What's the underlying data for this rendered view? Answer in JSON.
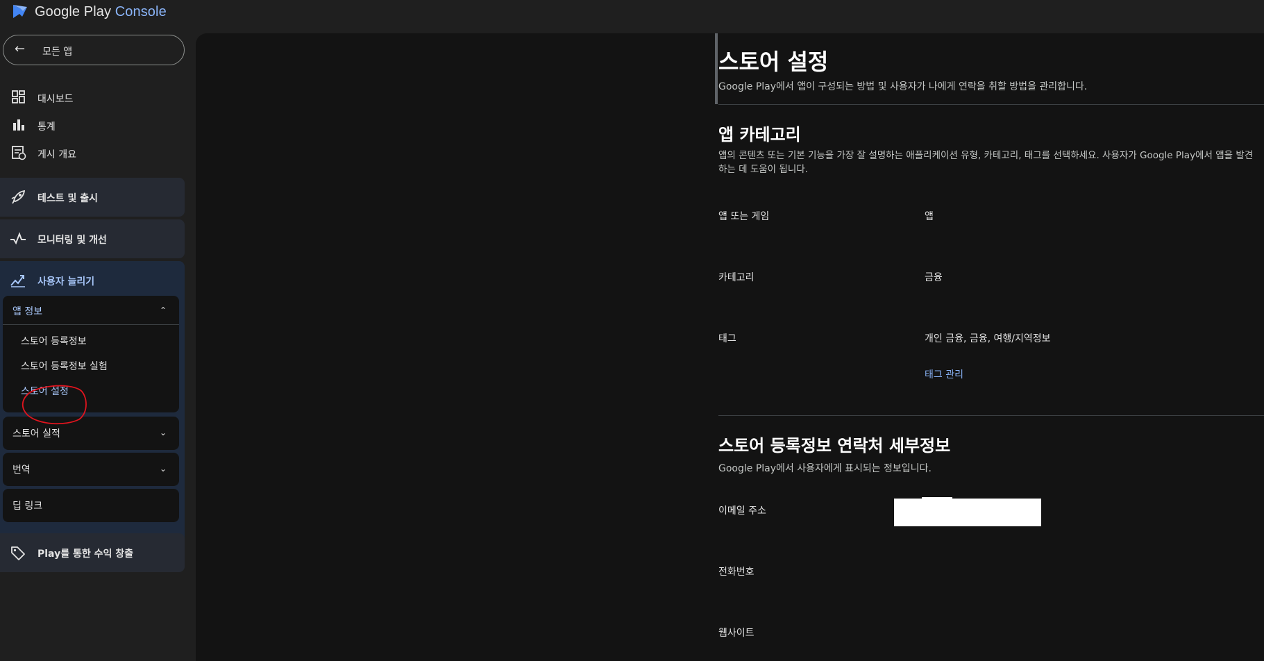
{
  "brand": {
    "name_part1": "Google Play ",
    "name_part2": "Console"
  },
  "sidebar": {
    "back_label": "모든 앱",
    "items": [
      {
        "label": "대시보드",
        "icon": "dashboard-icon"
      },
      {
        "label": "통계",
        "icon": "bar-chart-icon"
      },
      {
        "label": "게시 개요",
        "icon": "publishing-overview-icon"
      }
    ],
    "groups": [
      {
        "label": "테스트 및 출시",
        "icon": "rocket-icon"
      },
      {
        "label": "모니터링 및 개선",
        "icon": "pulse-icon"
      }
    ],
    "grow": {
      "label": "사용자 늘리기",
      "icon": "growth-chart-icon",
      "app_info": {
        "label": "앱 정보",
        "items": [
          "스토어 등록정보",
          "스토어 등록정보 실험",
          "스토어 설정"
        ]
      },
      "store_performance": "스토어 실적",
      "translation": "번역",
      "deep_links": "딥 링크"
    },
    "monetize": {
      "label": "Play를 통한 수익 창출",
      "icon": "tag-icon"
    }
  },
  "page": {
    "title": "스토어 설정",
    "subtitle": "Google Play에서 앱이 구성되는 방법 및 사용자가 나에게 연락을 취할 방법을 관리합니다.",
    "category_section": {
      "title": "앱 카테고리",
      "description": "앱의 콘텐츠 또는 기본 기능을 가장 잘 설명하는 애플리케이션 유형, 카테고리, 태그를 선택하세요. 사용자가 Google Play에서 앱을 발견하는 데 도움이 됩니다.",
      "rows": [
        {
          "label": "앱 또는 게임",
          "value": "앱"
        },
        {
          "label": "카테고리",
          "value": "금융"
        },
        {
          "label": "태그",
          "value": "개인 금융, 금융, 여행/지역정보"
        }
      ],
      "manage_tags_link": "태그 관리"
    },
    "contact_section": {
      "title": "스토어 등록정보 연락처 세부정보",
      "description": "Google Play에서 사용자에게 표시되는 정보입니다.",
      "rows": [
        {
          "label": "이메일 주소"
        },
        {
          "label": "전화번호"
        },
        {
          "label": "웹사이트"
        }
      ]
    }
  },
  "colors": {
    "accent": "#8ab4f8",
    "active_text": "#a8c7fa",
    "annotation": "#e0141e"
  }
}
